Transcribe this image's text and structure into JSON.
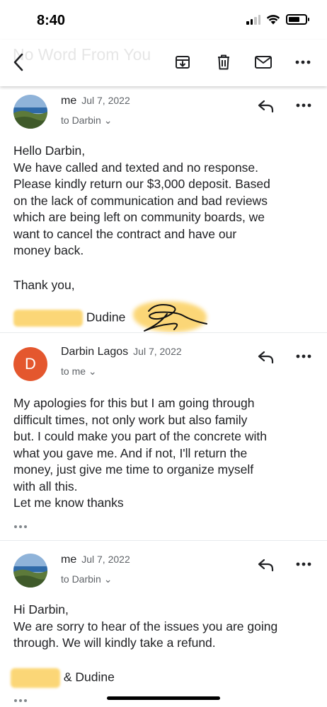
{
  "status_bar": {
    "time": "8:40"
  },
  "toolbar": {
    "faded_subject": "No Word From You",
    "actions": [
      "back-icon",
      "archive-icon",
      "delete-icon",
      "mark-unread-icon",
      "more-icon"
    ]
  },
  "messages": [
    {
      "sender": "me",
      "date": "Jul 7, 2022",
      "recipient": "to Darbin ⌄",
      "avatar": "landscape-photo",
      "body": [
        "Hello Darbin,",
        "We have called and texted and no response.",
        "Please kindly return our $3,000 deposit. Based",
        "on the lack of communication and bad reviews",
        "which are being left on community boards, we",
        "want to cancel the  contract and have our",
        "money back."
      ],
      "closing": "Thank you,",
      "signature_surname": "Dudine"
    },
    {
      "sender": "Darbin Lagos",
      "date": "Jul 7, 2022",
      "recipient": "to me ⌄",
      "avatar_letter": "D",
      "avatar_color": "#e4572e",
      "body": [
        "My apologies for this but I am going through",
        "difficult times, not only work but also family",
        "but.  I could make you part of the concrete with",
        "what you gave me. And if not, I'll return the",
        "money, just give me time to organize myself",
        "with all this.",
        "Let me know thanks"
      ]
    },
    {
      "sender": "me",
      "date": "Jul 7, 2022",
      "recipient": "to Darbin ⌄",
      "avatar": "landscape-photo",
      "body": [
        "Hi Darbin,",
        "We are sorry to hear of the issues you are going",
        "through. We will kindly take a refund."
      ],
      "signature_surname": "& Dudine"
    }
  ],
  "colors": {
    "redaction_highlight": "#fbd060",
    "secondary_text": "#5f6368",
    "avatar_d": "#e4572e"
  }
}
